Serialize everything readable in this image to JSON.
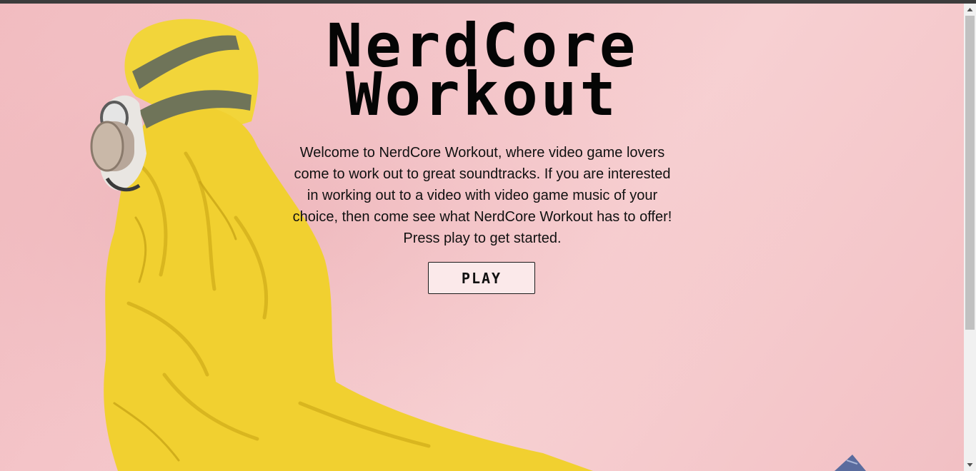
{
  "page": {
    "title_lines": [
      "NerdCore",
      "Workout"
    ],
    "intro": "Welcome to NerdCore Workout, where video game lovers come to work out to great soundtracks. If you are interested in working out to a video with video game music of your choice, then come see what NerdCore Workout has to offer! Press play to get started.",
    "play_label": "PLAY"
  },
  "colors": {
    "background": "#f3c4c7",
    "suit": "#f2d53a",
    "strap": "#6f7459",
    "button_bg": "#fbe9ea",
    "text": "#111111"
  },
  "icons": {
    "scroll_up": "triangle-up-icon",
    "scroll_down": "triangle-down-icon"
  }
}
